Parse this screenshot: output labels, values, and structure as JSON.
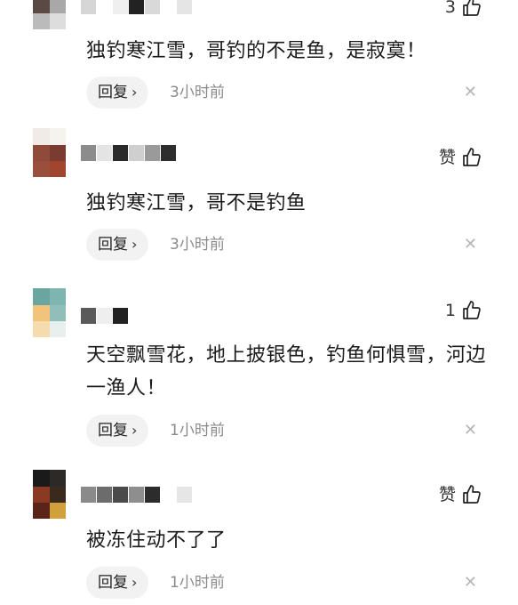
{
  "comments": [
    {
      "like_label": "3",
      "text": "独钓寒江雪，哥钓的不是鱼，是寂寞！",
      "reply_label": "回复",
      "time": "3小时前"
    },
    {
      "like_label": "赞",
      "text": "独钓寒江雪，哥不是钓鱼",
      "reply_label": "回复",
      "time": "3小时前"
    },
    {
      "like_label": "1",
      "text": "天空飘雪花，地上披银色，钓鱼何惧雪，河边一渔人！",
      "reply_label": "回复",
      "time": "1小时前"
    },
    {
      "like_label": "赞",
      "text": "被冻住动不了了",
      "reply_label": "回复",
      "time": "1小时前"
    }
  ],
  "icons": {
    "like": "thumbs-up-icon",
    "chevron": "chevron-right-icon",
    "close": "close-icon"
  },
  "colors": {
    "reply_bg": "#f2f2f2",
    "time": "#8a8a8a",
    "close": "#b5b5b5"
  }
}
